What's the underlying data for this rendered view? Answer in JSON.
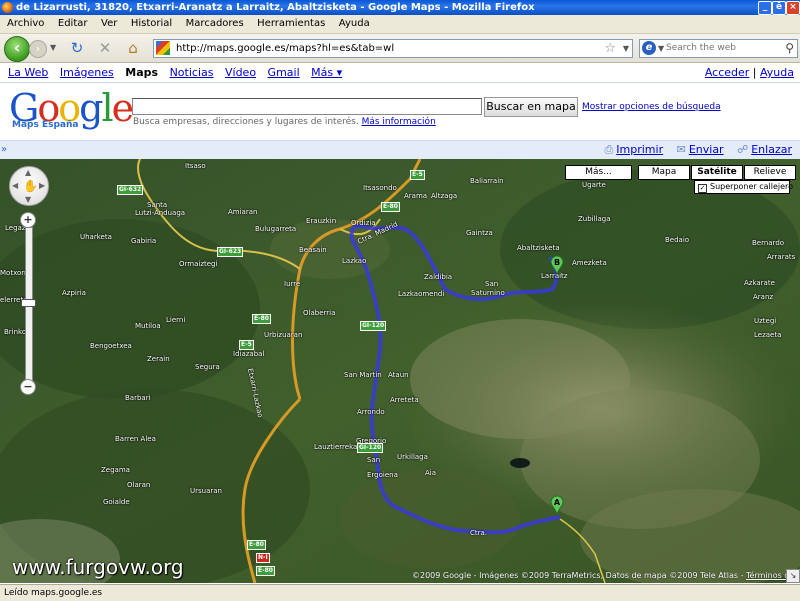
{
  "window": {
    "title": "de Lizarrusti, 31820, Etxarri-Aranatz a Larraitz, Abaltzisketa - Google Maps - Mozilla Firefox",
    "buttons": {
      "minimize": "_",
      "restore": "ē",
      "close": "×"
    }
  },
  "menu": [
    "Archivo",
    "Editar",
    "Ver",
    "Historial",
    "Marcadores",
    "Herramientas",
    "Ayuda"
  ],
  "navigation": {
    "url": "http://maps.google.es/maps?hl=es&tab=wl",
    "search_placeholder": "Search the web",
    "search_engine_letter": "e"
  },
  "google_bar": {
    "links": [
      "La Web",
      "Imágenes",
      "Maps",
      "Noticias",
      "Vídeo",
      "Gmail",
      "Más ▾"
    ],
    "current": "Maps",
    "sign_in": "Acceder",
    "separator": "|",
    "help": "Ayuda"
  },
  "header": {
    "logo_letters": [
      "G",
      "o",
      "o",
      "g",
      "l",
      "e"
    ],
    "logo_tm": "TM",
    "logo_sub": "Maps España",
    "search_value": "",
    "search_button": "Buscar en mapa",
    "advanced_link": "Mostrar opciones de búsqueda",
    "hint": "Busca empresas, direcciones y lugares de interés.",
    "hint_link": "Más información"
  },
  "toolbar": {
    "collapse": "»",
    "print": "Imprimir",
    "send": "Enviar",
    "link": "Enlazar"
  },
  "map": {
    "type_buttons": {
      "more": "Más...",
      "map": "Mapa",
      "satellite": "Satélite",
      "terrain": "Relieve"
    },
    "active_type": "Satélite",
    "overlay_label": "Superponer callejero",
    "overlay_checked": "✓",
    "zoom_in": "+",
    "zoom_out": "−",
    "copyright": "©2009 Google - Imágenes ©2009 TerraMetrics, Datos de mapa ©2009 Tele Atlas -",
    "terms": "Términos de uso",
    "watermark": "www.furgovw.org",
    "marker_a": "A",
    "marker_b": "B",
    "nub": "↘",
    "place_labels": {
      "itsaso": "Itsaso",
      "santa_lutxi": "Santa",
      "lutxi2": "Lutzi-Anduaga",
      "amiaran": "Amiaran",
      "uharketa": "Uharketa",
      "gabiria": "Gabiria",
      "bulugarreta": "Bulugarreta",
      "ormaiztegi": "Ormaiztegi",
      "beasain": "Beasain",
      "erauzkin": "Erauzkin",
      "ordizia": "Ordizia",
      "itsasondo": "Itsasondo",
      "arama": "Arama",
      "altzaga": "Altzaga",
      "baliarrain": "Baliarrain",
      "ugarte": "Ugarte",
      "zubillaga": "Zubillaga",
      "gaintza": "Gaintza",
      "bedaio": "Bedaio",
      "abaltzisketa": "Abaltzisketa",
      "amezketa": "Amezketa",
      "larraitz": "Larraitz",
      "zaldibia": "Zaldibia",
      "san": "San",
      "saturnino": "Saturnino",
      "lazkaomendi": "Lazkaomendi",
      "lazkao": "Lazkao",
      "legazpi": "Legazpi",
      "motxorro": "Motxorro",
      "azpiria": "Azpiria",
      "elerreta": "elerreta",
      "brinkola": "Brinkola",
      "mutiloa": "Mutiloa",
      "lierni": "Lierni",
      "iurre": "Iurre",
      "olaberria": "Olaberria",
      "urbizuaran": "Urbizuaran",
      "idiazabal": "Idiazabal",
      "bengoetxea": "Bengoetxea",
      "zerain": "Zerain",
      "segura": "Segura",
      "barbari": "Barbari",
      "barren_alea": "Barren Alea",
      "zegama": "Zegama",
      "olaran": "Olaran",
      "ursuaran": "Ursuaran",
      "goialde": "Goialde",
      "san_martin": "San Martin",
      "ataun": "Ataun",
      "arreteta": "Arreteta",
      "arrondo": "Arrondo",
      "lauztierreka": "Lauztierreka",
      "san2": "San",
      "gregorio": "Gregorio",
      "urkillaga": "Urkillaga",
      "ergoiena": "Ergoiena",
      "aia": "Aia",
      "azkarate": "Azkarate",
      "aranz": "Aranz",
      "uztegi": "Uztegi",
      "lezaeta": "Lezaeta",
      "arrarats": "Arrarats",
      "bernardo": "Bernardo"
    },
    "road_labels": {
      "gi632": "GI-632",
      "gi623": "GI-623",
      "e5a": "E-5",
      "e80a": "E-80",
      "e80b": "E-80",
      "e5b": "E-5",
      "gi120a": "GI-120",
      "gi120b": "GI-120",
      "e80c": "E-80",
      "ni": "N-I",
      "e80d": "E-80",
      "road_name": "Etxarri-Lazkao",
      "road_name2": "Ctra. Madrid",
      "road_name3": "Ctra."
    }
  },
  "status": "Leído maps.google.es"
}
